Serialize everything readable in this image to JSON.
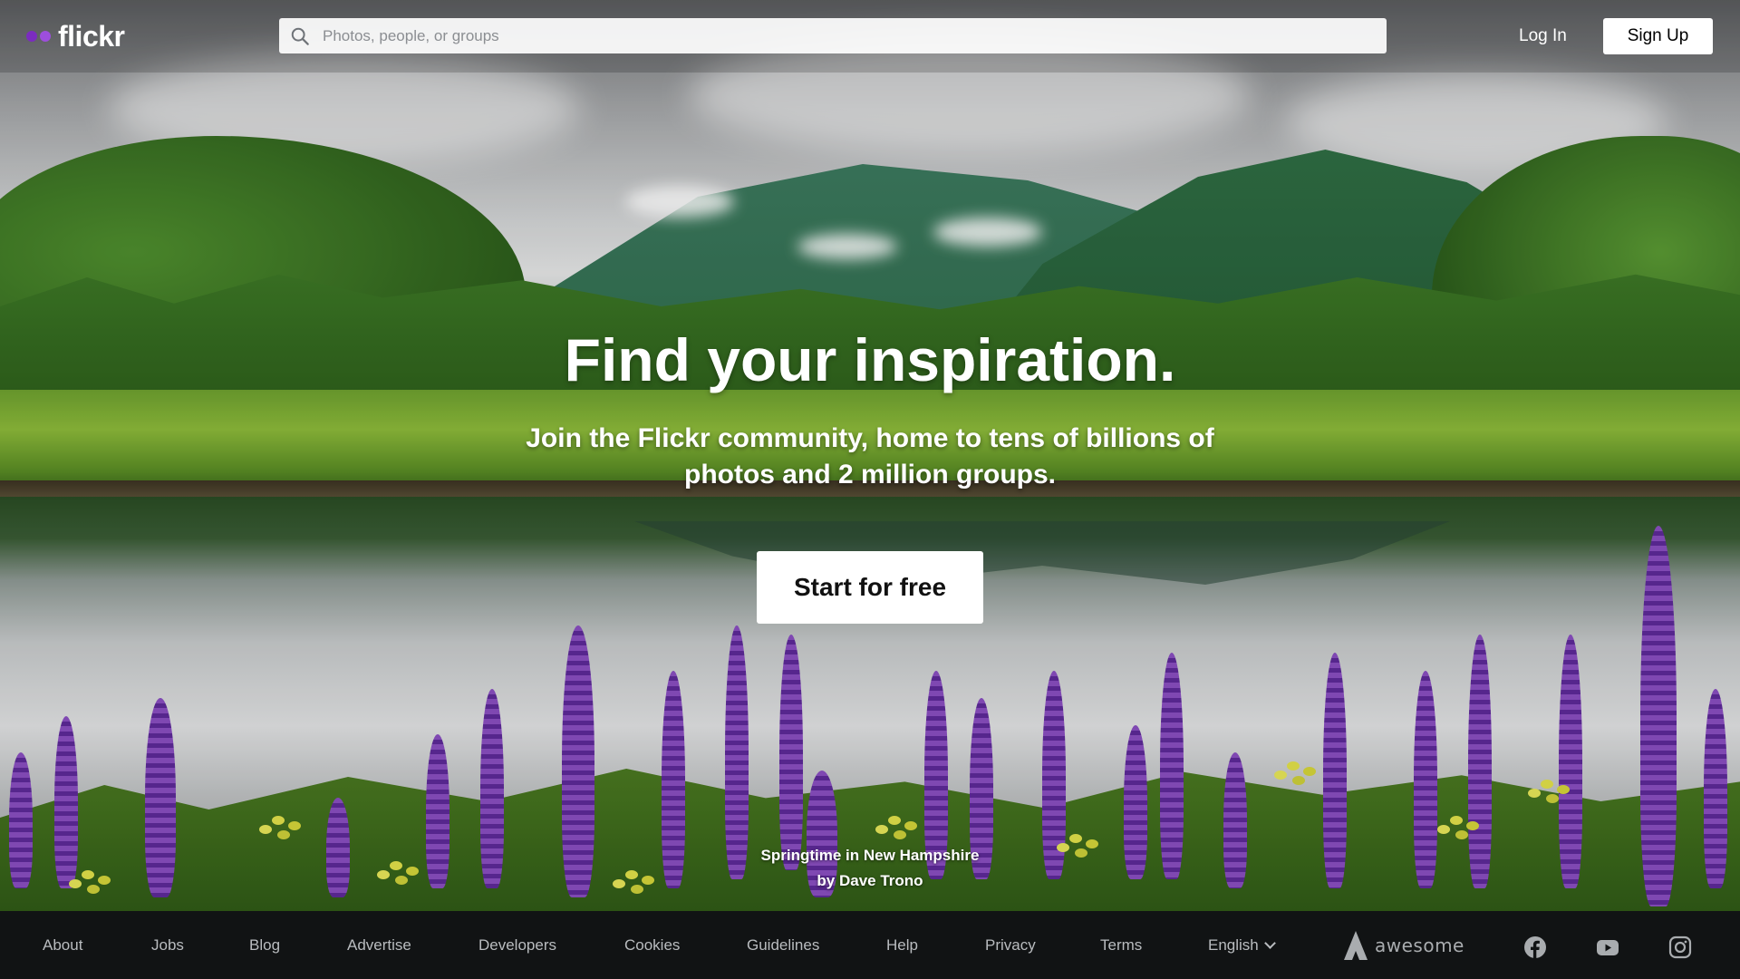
{
  "brand": {
    "name": "flickr",
    "dot_colors": [
      "#7b2cbf",
      "#9d4edd"
    ]
  },
  "header": {
    "search_placeholder": "Photos, people, or groups",
    "login_label": "Log In",
    "signup_label": "Sign Up"
  },
  "hero": {
    "headline": "Find your inspiration.",
    "subheadline": "Join the Flickr community, home to tens of billions of photos and 2 million groups.",
    "cta_label": "Start for free",
    "photo_title": "Springtime in New Hampshire",
    "photo_credit": "by Dave Trono"
  },
  "footer": {
    "links": [
      "About",
      "Jobs",
      "Blog",
      "Advertise",
      "Developers",
      "Cookies",
      "Guidelines",
      "Help",
      "Privacy",
      "Terms"
    ],
    "language": "English",
    "partner_name": "awesome",
    "social_icons": [
      "facebook-icon",
      "youtube-icon",
      "instagram-icon"
    ]
  },
  "colors": {
    "footer_bg": "#111314",
    "accent": "#7b2cbf"
  }
}
